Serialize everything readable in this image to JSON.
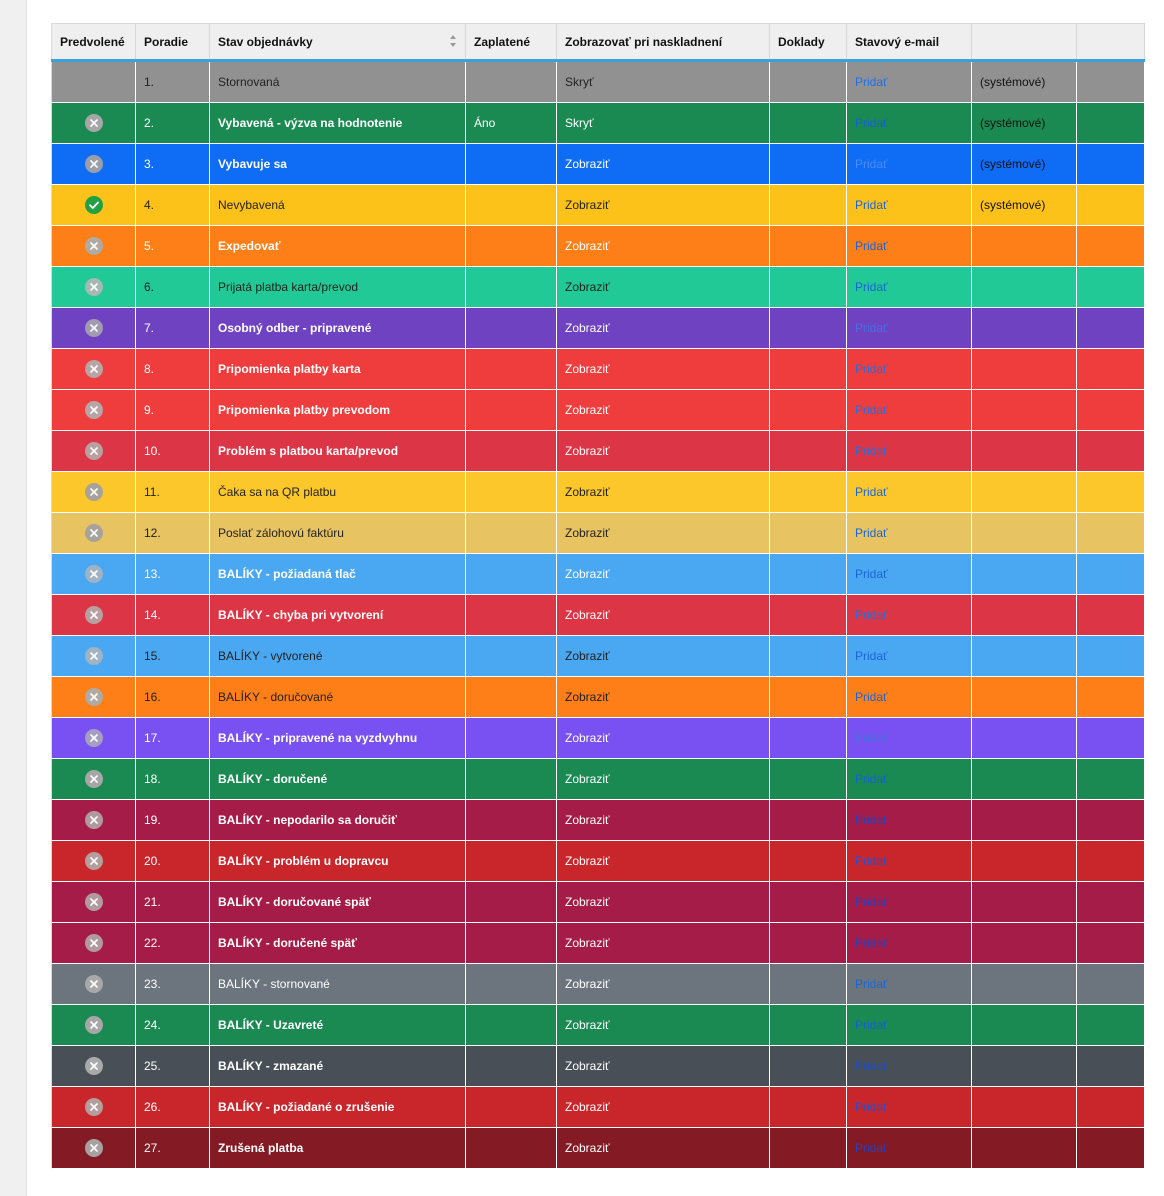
{
  "header": {
    "columns": [
      "Predvolené",
      "Poradie",
      "Stav objednávky",
      "Zaplatené",
      "Zobrazovať pri naskladnení",
      "Doklady",
      "Stavový e-mail",
      "",
      ""
    ]
  },
  "action": {
    "add_label": "Pridať"
  },
  "rows": [
    {
      "default": "none",
      "order": "1.",
      "name": "Stornovaná",
      "paid": "",
      "display": "Skryť",
      "email": "Pridať",
      "note": "(systémové)",
      "bg": "#919191",
      "text": "#222",
      "bold": false,
      "link": "#1f6fe5",
      "iconbg": "#b9b9b9"
    },
    {
      "default": "cross",
      "order": "2.",
      "name": "Vybavená - výzva na hodnotenie",
      "paid": "Áno",
      "display": "Skryť",
      "email": "Pridať",
      "note": "(systémové)",
      "bg": "#1a8a52",
      "text": "#fff",
      "bold": true,
      "link": "#1560d0",
      "iconbg": "#a6a6a6"
    },
    {
      "default": "cross",
      "order": "3.",
      "name": "Vybavuje sa",
      "paid": "",
      "display": "Zobraziť",
      "email": "Pridať",
      "note": "(systémové)",
      "bg": "#0f6cf5",
      "text": "#fff",
      "bold": true,
      "link": "#4a8cf8",
      "iconbg": "#9a9ea8"
    },
    {
      "default": "check",
      "order": "4.",
      "name": "Nevybavená",
      "paid": "",
      "display": "Zobraziť",
      "email": "Pridať",
      "note": "(systémové)",
      "bg": "#fcc21a",
      "text": "#222",
      "bold": false,
      "link": "#1a66d6",
      "iconbg": "#23a043"
    },
    {
      "default": "cross",
      "order": "5.",
      "name": "Expedovať",
      "paid": "",
      "display": "Zobraziť",
      "email": "Pridať",
      "note": "",
      "bg": "#fe7e17",
      "text": "#fff",
      "bold": true,
      "link": "#1a66d6",
      "iconbg": "#b0aaa2"
    },
    {
      "default": "cross",
      "order": "6.",
      "name": "Prijatá platba karta/prevod",
      "paid": "",
      "display": "Zobraziť",
      "email": "Pridať",
      "note": "",
      "bg": "#20c995",
      "text": "#222",
      "bold": false,
      "link": "#1a66d6",
      "iconbg": "#a3b9b1"
    },
    {
      "default": "cross",
      "order": "7.",
      "name": "Osobný odber - pripravené",
      "paid": "",
      "display": "Zobraziť",
      "email": "Pridať",
      "note": "",
      "bg": "#6f42c1",
      "text": "#fff",
      "bold": true,
      "link": "#4a6fe0",
      "iconbg": "#a29ab0"
    },
    {
      "default": "cross",
      "order": "8.",
      "name": "Pripomienka platby karta",
      "paid": "",
      "display": "Zobraziť",
      "email": "Pridať",
      "note": "",
      "bg": "#ef3c3c",
      "text": "#fff",
      "bold": true,
      "link": "#2c6cd4",
      "iconbg": "#b8a4a4"
    },
    {
      "default": "cross",
      "order": "9.",
      "name": "Pripomienka platby prevodom",
      "paid": "",
      "display": "Zobraziť",
      "email": "Pridať",
      "note": "",
      "bg": "#ef3c3c",
      "text": "#fff",
      "bold": true,
      "link": "#2c6cd4",
      "iconbg": "#b8a4a4"
    },
    {
      "default": "cross",
      "order": "10.",
      "name": "Problém s platbou karta/prevod",
      "paid": "",
      "display": "Zobraziť",
      "email": "Pridať",
      "note": "",
      "bg": "#dc3545",
      "text": "#fff",
      "bold": true,
      "link": "#2c6cd4",
      "iconbg": "#b8a0a0"
    },
    {
      "default": "cross",
      "order": "11.",
      "name": "Čaka sa na QR platbu",
      "paid": "",
      "display": "Zobraziť",
      "email": "Pridať",
      "note": "",
      "bg": "#fcc72a",
      "text": "#222",
      "bold": false,
      "link": "#1a66d6",
      "iconbg": "#a7a39a"
    },
    {
      "default": "cross",
      "order": "12.",
      "name": "Poslať zálohovú faktúru",
      "paid": "",
      "display": "Zobraziť",
      "email": "Pridať",
      "note": "",
      "bg": "#e7c362",
      "text": "#222",
      "bold": false,
      "link": "#1a66d6",
      "iconbg": "#a8a39a"
    },
    {
      "default": "cross",
      "order": "13.",
      "name": "BALÍKY - požiadaná tlač",
      "paid": "",
      "display": "Zobraziť",
      "email": "Pridať",
      "note": "",
      "bg": "#4aa8f2",
      "text": "#fff",
      "bold": true,
      "link": "#1a66d6",
      "iconbg": "#9fb3c4"
    },
    {
      "default": "cross",
      "order": "14.",
      "name": "BALÍKY - chyba pri vytvorení",
      "paid": "",
      "display": "Zobraziť",
      "email": "Pridať",
      "note": "",
      "bg": "#dc3545",
      "text": "#fff",
      "bold": true,
      "link": "#2c6cd4",
      "iconbg": "#b8a0a0"
    },
    {
      "default": "cross",
      "order": "15.",
      "name": "BALÍKY - vytvorené",
      "paid": "",
      "display": "Zobraziť",
      "email": "Pridať",
      "note": "",
      "bg": "#4aa8f2",
      "text": "#222",
      "bold": false,
      "link": "#1a66d6",
      "iconbg": "#9fb3c4"
    },
    {
      "default": "cross",
      "order": "16.",
      "name": "BALÍKY - doručované",
      "paid": "",
      "display": "Zobraziť",
      "email": "Pridať",
      "note": "",
      "bg": "#fe7e17",
      "text": "#222",
      "bold": false,
      "link": "#1a66d6",
      "iconbg": "#b0aaa2"
    },
    {
      "default": "cross",
      "order": "17.",
      "name": "BALÍKY - pripravené na vyzdvyhnu",
      "paid": "",
      "display": "Zobraziť",
      "email": "Pridať",
      "note": "",
      "bg": "#7950f2",
      "text": "#fff",
      "bold": true,
      "link": "#4a6fe0",
      "iconbg": "#a49ec0"
    },
    {
      "default": "cross",
      "order": "18.",
      "name": "BALÍKY - doručené",
      "paid": "",
      "display": "Zobraziť",
      "email": "Pridať",
      "note": "",
      "bg": "#1a8a52",
      "text": "#fff",
      "bold": true,
      "link": "#1560d0",
      "iconbg": "#a6a6a6"
    },
    {
      "default": "cross",
      "order": "19.",
      "name": "BALÍKY - nepodarilo sa doručiť",
      "paid": "",
      "display": "Zobraziť",
      "email": "Pridať",
      "note": "",
      "bg": "#a61c49",
      "text": "#fff",
      "bold": true,
      "link": "#2a3fb8",
      "iconbg": "#b19a9f"
    },
    {
      "default": "cross",
      "order": "20.",
      "name": "BALÍKY - problém u dopravcu",
      "paid": "",
      "display": "Zobraziť",
      "email": "Pridať",
      "note": "",
      "bg": "#c9262b",
      "text": "#fff",
      "bold": true,
      "link": "#2c4ec8",
      "iconbg": "#b49d9d"
    },
    {
      "default": "cross",
      "order": "21.",
      "name": "BALÍKY - doručované späť",
      "paid": "",
      "display": "Zobraziť",
      "email": "Pridať",
      "note": "",
      "bg": "#a61c49",
      "text": "#fff",
      "bold": true,
      "link": "#2a3fb8",
      "iconbg": "#b19a9f"
    },
    {
      "default": "cross",
      "order": "22.",
      "name": "BALÍKY - doručené späť",
      "paid": "",
      "display": "Zobraziť",
      "email": "Pridať",
      "note": "",
      "bg": "#a61c49",
      "text": "#fff",
      "bold": true,
      "link": "#2a3fb8",
      "iconbg": "#b19a9f"
    },
    {
      "default": "cross",
      "order": "23.",
      "name": "BALÍKY - stornované",
      "paid": "",
      "display": "Zobraziť",
      "email": "Pridať",
      "note": "",
      "bg": "#6c757d",
      "text": "#fff",
      "bold": false,
      "link": "#1a66d6",
      "iconbg": "#a8a8a8"
    },
    {
      "default": "cross",
      "order": "24.",
      "name": "BALÍKY - Uzavreté",
      "paid": "",
      "display": "Zobraziť",
      "email": "Pridať",
      "note": "",
      "bg": "#1a8a52",
      "text": "#fff",
      "bold": true,
      "link": "#1560d0",
      "iconbg": "#a6a6a6"
    },
    {
      "default": "cross",
      "order": "25.",
      "name": "BALÍKY - zmazané",
      "paid": "",
      "display": "Zobraziť",
      "email": "Pridať",
      "note": "",
      "bg": "#484f57",
      "text": "#fff",
      "bold": true,
      "link": "#1d4fbf",
      "iconbg": "#a9a9a9"
    },
    {
      "default": "cross",
      "order": "26.",
      "name": "BALÍKY - požiadané o zrušenie",
      "paid": "",
      "display": "Zobraziť",
      "email": "Pridať",
      "note": "",
      "bg": "#c9262b",
      "text": "#fff",
      "bold": true,
      "link": "#2c4ec8",
      "iconbg": "#b49d9d"
    },
    {
      "default": "cross",
      "order": "27.",
      "name": "Zrušená platba",
      "paid": "",
      "display": "Zobraziť",
      "email": "Pridať",
      "note": "",
      "bg": "#841a23",
      "text": "#fff",
      "bold": true,
      "link": "#2a3fb8",
      "iconbg": "#a9a1a1"
    }
  ]
}
